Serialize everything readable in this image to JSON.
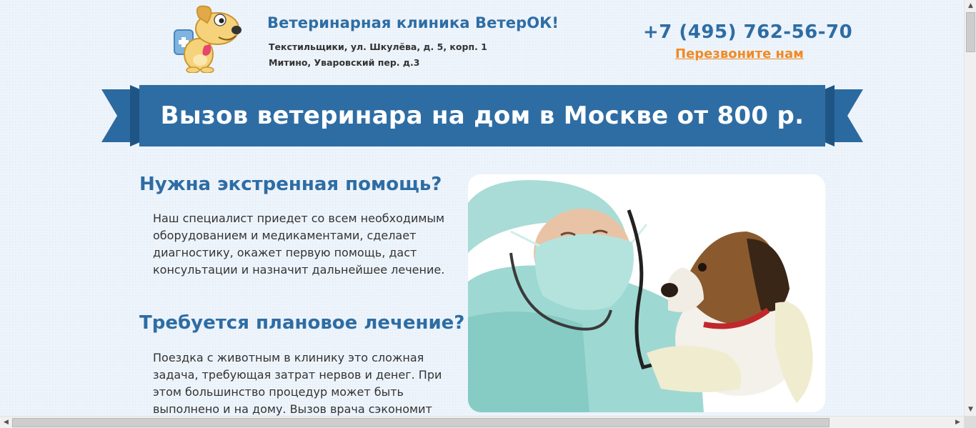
{
  "header": {
    "clinic_name": "Ветеринарная клиника ВетерОК!",
    "address_1": "Текстильщики, ул. Шкулёва, д. 5, корп. 1",
    "address_2": "Митино, Уваровский пер. д.3",
    "phone": "+7 (495) 762-56-70",
    "callback_label": "Перезвоните нам"
  },
  "banner": {
    "title": "Вызов ветеринара на дом в Москве от 800 р."
  },
  "sections": [
    {
      "heading": "Нужна экстренная помощь?",
      "text": "Наш специалист приедет со всем необходимым оборудованием и медикаментами, сделает диагностику, окажет первую помощь, даст консультации и назначит дальнейшее лечение."
    },
    {
      "heading": "Требуется плановое лечение?",
      "text": "Поездка с животным в клинику это сложная задача, требующая затрат нервов и денег. При этом большинство процедур может быть выполнено и на дому. Вызов врача сэкономит"
    }
  ],
  "colors": {
    "brand_blue": "#2e6da4",
    "ribbon_blue": "#2b6aa0",
    "ribbon_dark": "#1f5585",
    "accent_orange": "#f08a24"
  },
  "icons": {
    "logo": "cartoon-dog-vet-logo",
    "scroll_up": "arrow-up-icon",
    "scroll_down": "arrow-down-icon",
    "scroll_left": "arrow-left-icon",
    "scroll_right": "arrow-right-icon"
  }
}
